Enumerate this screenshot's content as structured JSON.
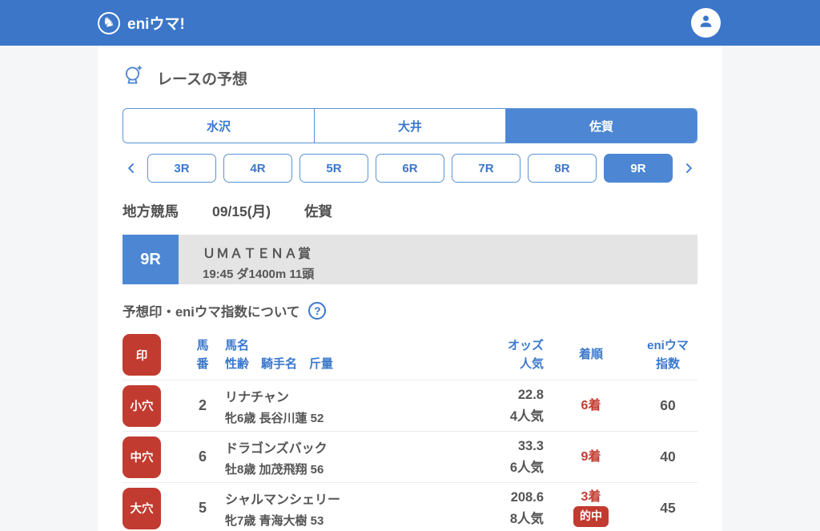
{
  "colors": {
    "appbar_blue": "#3b76c9",
    "active_blue": "#4d87d3",
    "link_blue": "#3a78cc",
    "accent_red": "#c23b30",
    "banner_gray": "#e4e4e4",
    "page_bg": "#f4f6f8"
  },
  "icons": {
    "horse_logo": "♞",
    "avatar": "person-silhouette",
    "page_title_icon": "crystal-ball-with-sparkle",
    "help": "?",
    "chevron_left": "‹",
    "chevron_right": "›"
  },
  "appbar": {
    "logo_text": "eniウマ!"
  },
  "page": {
    "title": "レースの予想"
  },
  "track_tabs": [
    {
      "label": "水沢",
      "active": false
    },
    {
      "label": "大井",
      "active": false
    },
    {
      "label": "佐賀",
      "active": true
    }
  ],
  "race_selector": {
    "races": [
      {
        "label": "3R"
      },
      {
        "label": "4R"
      },
      {
        "label": "5R"
      },
      {
        "label": "6R"
      },
      {
        "label": "7R"
      },
      {
        "label": "8R"
      },
      {
        "label": "9R"
      }
    ],
    "selected": "9R"
  },
  "race_meta": {
    "category": "地方競馬",
    "date": "09/15(月)",
    "track": "佐賀"
  },
  "race_banner": {
    "race_no": "9R",
    "title": "ＵＭＡＴＥＮＡ賞",
    "details": "19:45 ダ1400m 11頭"
  },
  "about": {
    "label": "予想印・eniウマ指数について"
  },
  "table": {
    "headers": {
      "mark": "印",
      "no_l1": "馬",
      "no_l2": "番",
      "name_l1": "馬名",
      "name_l2": "性齢　騎手名　斤量",
      "odds_l1": "オッズ",
      "odds_l2": "人気",
      "result": "着順",
      "index_l1": "eniウマ",
      "index_l2": "指数"
    },
    "rows": [
      {
        "mark": "小穴",
        "horse_no": "2",
        "name": "リナチャン",
        "profile": "牝6歳 長谷川蓮 52",
        "odds": "22.8",
        "popularity": "4人気",
        "result": "6着",
        "index": "60"
      },
      {
        "mark": "中穴",
        "horse_no": "6",
        "name": "ドラゴンズバック",
        "profile": "牡8歳 加茂飛翔 56",
        "odds": "33.3",
        "popularity": "6人気",
        "result": "9着",
        "index": "40"
      },
      {
        "mark": "大穴",
        "horse_no": "5",
        "name": "シャルマンシェリー",
        "profile": "牝7歳 青海大樹 53",
        "odds": "208.6",
        "popularity": "8人気",
        "result": "3着",
        "hit_label": "的中",
        "index": "45"
      }
    ]
  }
}
